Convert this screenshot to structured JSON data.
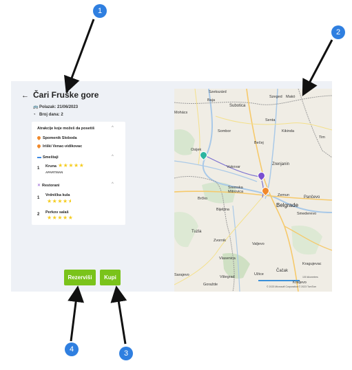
{
  "header": {
    "back_icon": "←",
    "title": "Čari Fruške gore",
    "departure_icon": "bus-icon",
    "departure": "Polazak: 21/06/2023",
    "days_icon": "clock-icon",
    "days": "Broj dana: 2"
  },
  "attractions": {
    "heading": "Atrakcije koje možeš da posetiš",
    "items": [
      "Spomenik Sloboda",
      "Iriški Venac-vidikovac"
    ]
  },
  "accommodation": {
    "heading": "Smeštaji",
    "items": [
      {
        "number": "1",
        "name": "Kruna",
        "type": "APARTMAN",
        "rating": 5
      }
    ]
  },
  "restaurants": {
    "heading": "Restorani",
    "items": [
      {
        "number": "1",
        "name": "Vrdnička kula",
        "rating": 4.5
      },
      {
        "number": "2",
        "name": "Perkov salaš",
        "rating": 5
      }
    ]
  },
  "buttons": {
    "reserve": "Rezerviši",
    "buy": "Kupi"
  },
  "map": {
    "labels": {
      "szeged": "Szeged",
      "mako": "Makó",
      "szekszard": "Szekszárd",
      "baja": "Baja",
      "mohacs": "Mohács",
      "subotica": "Subotica",
      "senta": "Senta",
      "kikinda": "Kikinda",
      "tim": "Tim",
      "sombor": "Sombor",
      "becej": "Bečej",
      "osijek": "Osijek",
      "vukovar": "Vukovar",
      "zrenjanin": "Zrenjanin",
      "sremska": "Sremska\nMitrovica",
      "zemun": "Zemun",
      "pancevo": "Pančevo",
      "belgrade": "Belgrade",
      "smederevo": "Smederevo",
      "brcko": "Brčko",
      "bijeljina": "Bijeljina",
      "tuzla": "Tuzla",
      "zvornik": "Zvornik",
      "valjevo": "Valjevo",
      "vlasenica": "Vlasenica",
      "kragujevac": "Kragujevac",
      "cacak": "Čačak",
      "sarajevo": "Sarajevo",
      "uzice": "Užice",
      "visegrad": "Višegrad",
      "gorazde": "Goražde",
      "kraljevo": "Kraljevo"
    },
    "scale": "100 kilometers",
    "copyright": "© 2023 Microsoft Corporation  © 2023 TomTom"
  },
  "callouts": [
    "1",
    "2",
    "3",
    "4"
  ],
  "colors": {
    "button": "#7ac31a",
    "pin": "#f0892b",
    "star": "#f5cc1f",
    "callout": "#2f7fe0"
  }
}
